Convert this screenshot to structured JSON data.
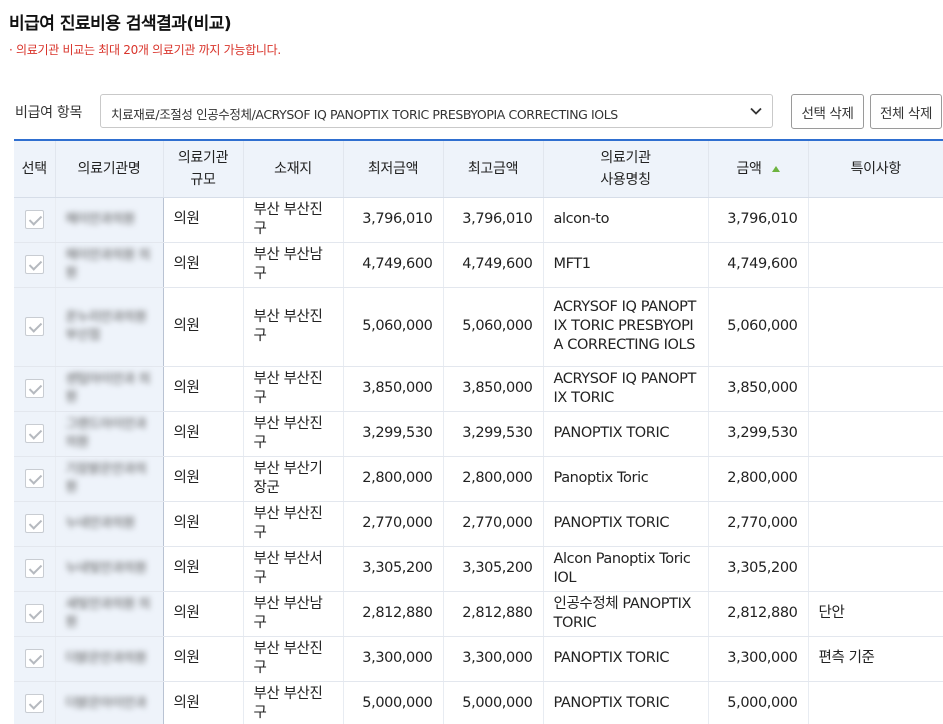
{
  "page": {
    "title": "비급여 진료비용 검색결과(비교)",
    "notice": "· 의료기관 비교는 최대 20개 의료기관 까지 가능합니다."
  },
  "filter": {
    "label": "비급여 항목",
    "value": "치료재료/조절성 인공수정체/ACRYSOF IQ PANOPTIX TORIC PRESBYOPIA CORRECTING IOLS"
  },
  "buttons": {
    "delete_selected": "선택 삭제",
    "delete_all": "전체 삭제"
  },
  "table": {
    "headers": {
      "select": "선택",
      "name": "의료기관명",
      "scale_1": "의료기관",
      "scale_2": "규모",
      "location": "소재지",
      "min_price": "최저금액",
      "max_price": "최고금액",
      "product_1": "의료기관",
      "product_2": "사용명칭",
      "price": "금액",
      "note": "특이사항"
    },
    "rows": [
      {
        "name": "헤이안과의원",
        "scale": "의원",
        "location": "부산 부산진구",
        "min": "3,796,010",
        "max": "3,796,010",
        "product": "alcon-to",
        "price": "3,796,010",
        "note": ""
      },
      {
        "name": "헤이안과의원 의원",
        "scale": "의원",
        "location": "부산 부산남구",
        "min": "4,749,600",
        "max": "4,749,600",
        "product": "MFT1",
        "price": "4,749,600",
        "note": ""
      },
      {
        "name": "온누리안과의원 부산점",
        "scale": "의원",
        "location": "부산 부산진구",
        "min": "5,060,000",
        "max": "5,060,000",
        "product": "ACRYSOF IQ PANOPTIX TORIC PRESBYOPIA CORRECTING IOLS",
        "price": "5,060,000",
        "note": ""
      },
      {
        "name": "센텀아이안과 의원",
        "scale": "의원",
        "location": "부산 부산진구",
        "min": "3,850,000",
        "max": "3,850,000",
        "product": "ACRYSOF IQ PANOPTIX TORIC",
        "price": "3,850,000",
        "note": ""
      },
      {
        "name": "그랜드아이안과의원",
        "scale": "의원",
        "location": "부산 부산진구",
        "min": "3,299,530",
        "max": "3,299,530",
        "product": "PANOPTIX TORIC",
        "price": "3,299,530",
        "note": ""
      },
      {
        "name": "기장밝은안과의원",
        "scale": "의원",
        "location": "부산 부산기장군",
        "min": "2,800,000",
        "max": "2,800,000",
        "product": "Panoptix Toric",
        "price": "2,800,000",
        "note": ""
      },
      {
        "name": "누네안과의원",
        "scale": "의원",
        "location": "부산 부산진구",
        "min": "2,770,000",
        "max": "2,770,000",
        "product": "PANOPTIX TORIC",
        "price": "2,770,000",
        "note": ""
      },
      {
        "name": "누네빛안과의원",
        "scale": "의원",
        "location": "부산 부산서구",
        "min": "3,305,200",
        "max": "3,305,200",
        "product": "Alcon Panoptix Toric IOL",
        "price": "3,305,200",
        "note": ""
      },
      {
        "name": "새빛안과의원 의원",
        "scale": "의원",
        "location": "부산 부산남구",
        "min": "2,812,880",
        "max": "2,812,880",
        "product": "인공수정체  PANOPTIX TORIC",
        "price": "2,812,880",
        "note": "단안"
      },
      {
        "name": "더밝은안과의원",
        "scale": "의원",
        "location": "부산 부산진구",
        "min": "3,300,000",
        "max": "3,300,000",
        "product": "PANOPTIX TORIC",
        "price": "3,300,000",
        "note": "편측 기준"
      },
      {
        "name": "더밝은아이안과",
        "scale": "의원",
        "location": "부산 부산진구",
        "min": "5,000,000",
        "max": "5,000,000",
        "product": "PANOPTIX TORIC",
        "price": "5,000,000",
        "note": ""
      }
    ]
  },
  "colors": {
    "accent": "#2f6fd0",
    "notice": "#d9342b",
    "header_bg": "#eef3fa",
    "sort_icon": "#6db33f"
  }
}
